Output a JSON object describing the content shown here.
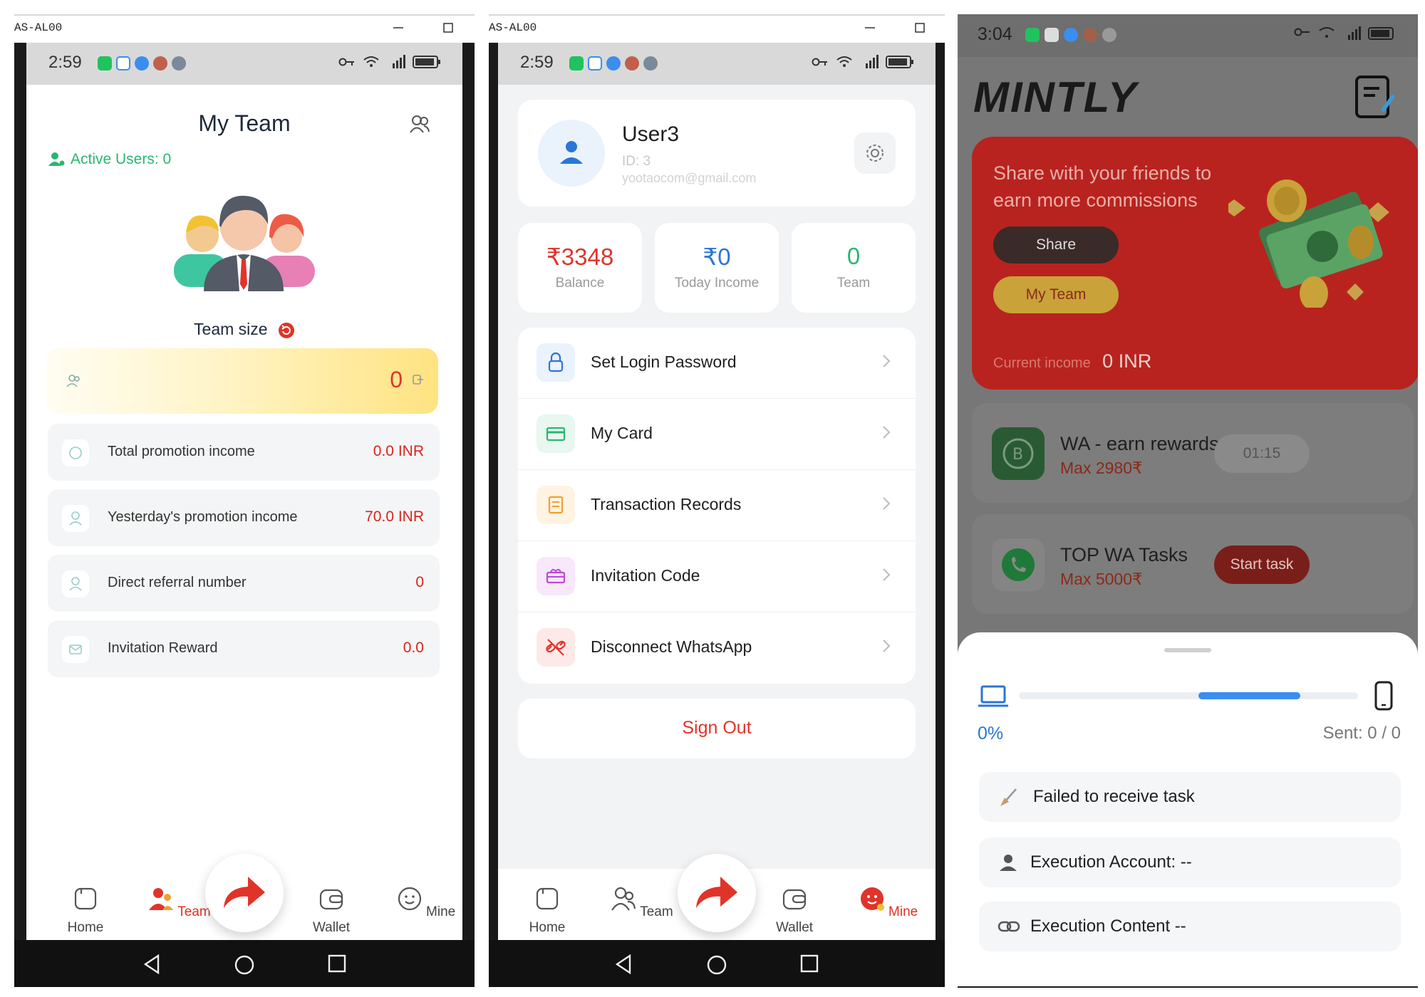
{
  "panel1": {
    "window_title": "AS-AL00",
    "status_time": "2:59",
    "title": "My Team",
    "active_users": "Active Users: 0",
    "team_size_label": "Team size",
    "team_size_value": "0",
    "rows": [
      {
        "label": "Total promotion income",
        "value": "0.0 INR",
        "icon": "coin-icon"
      },
      {
        "label": "Yesterday's promotion income",
        "value": "70.0 INR",
        "icon": "user-coin-icon"
      },
      {
        "label": "Direct referral number",
        "value": "0",
        "icon": "user-icon"
      },
      {
        "label": "Invitation Reward",
        "value": "0.0",
        "icon": "envelope-icon"
      }
    ],
    "nav": {
      "home": "Home",
      "team": "Team",
      "wallet": "Wallet",
      "mine": "Mine",
      "active": "Team"
    }
  },
  "panel2": {
    "window_title": "AS-AL00",
    "status_time": "2:59",
    "user_name": "User3",
    "user_id": "ID: 3",
    "user_email": "yootaocom@gmail.com",
    "stats": [
      {
        "value": "₹3348",
        "label": "Balance",
        "color": "#e0342a"
      },
      {
        "value": "₹0",
        "label": "Today Income",
        "color": "#2a76d6"
      },
      {
        "value": "0",
        "label": "Team",
        "color": "#2bb673"
      }
    ],
    "menu": [
      {
        "label": "Set Login Password",
        "icon": "lock-icon",
        "color": "#2a76d6",
        "bg": "#eaf2fc"
      },
      {
        "label": "My Card",
        "icon": "card-icon",
        "color": "#2bb673",
        "bg": "#e8f7ef"
      },
      {
        "label": "Transaction Records",
        "icon": "receipt-icon",
        "color": "#f0a030",
        "bg": "#fff3e2"
      },
      {
        "label": "Invitation Code",
        "icon": "gift-icon",
        "color": "#c046d6",
        "bg": "#f7e8fb"
      },
      {
        "label": "Disconnect WhatsApp",
        "icon": "unlink-icon",
        "color": "#e0342a",
        "bg": "#fde9e8"
      }
    ],
    "sign_out": "Sign Out",
    "nav": {
      "home": "Home",
      "team": "Team",
      "wallet": "Wallet",
      "mine": "Mine",
      "active": "Mine"
    }
  },
  "panel3": {
    "status_time": "3:04",
    "brand": "MINTLY",
    "promo_text_line1": "Share with your friends to",
    "promo_text_line2": "earn more commissions",
    "share_button": "Share",
    "my_team_button": "My Team",
    "current_income_label": "Current income",
    "current_income_value": "0 INR",
    "tasks": [
      {
        "title": "WA - earn rewards",
        "max": "Max 2980₹",
        "button": "01:15",
        "icon": "whatsapp-business-icon"
      },
      {
        "title": "TOP WA Tasks",
        "max": "Max 5000₹",
        "button": "Start task",
        "icon": "whatsapp-icon"
      }
    ],
    "progress_percent": "0%",
    "progress_fill": 0.3,
    "sent": "Sent: 0 / 0",
    "failed_message": "Failed to receive task",
    "execution_account": "Execution Account: --",
    "execution_content": "Execution Content --"
  },
  "colors": {
    "accent_red": "#e0342a",
    "accent_green": "#2bb673",
    "accent_blue": "#2a76d6",
    "promo_red": "#b8231f"
  }
}
